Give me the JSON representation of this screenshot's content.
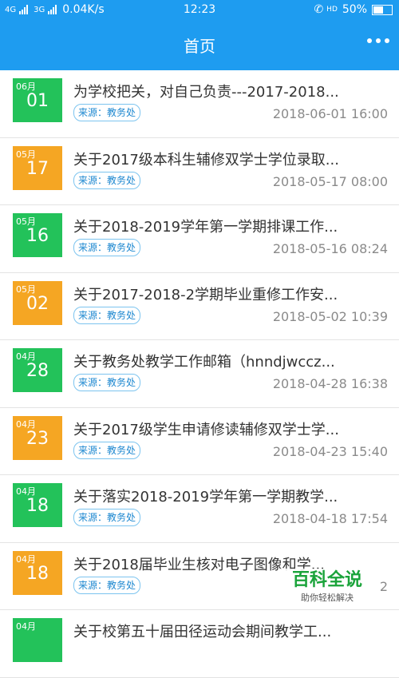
{
  "status": {
    "signal_left": "4G",
    "signal_right": "3G",
    "speed": "0.04K/s",
    "time": "12:23",
    "network": "HD",
    "battery": "50%"
  },
  "header": {
    "title": "首页"
  },
  "items": [
    {
      "month": "06月",
      "day": "01",
      "color": "#23c25a",
      "title": "为学校把关，对自己负责---2017-2018...",
      "source": "来源：教务处",
      "time": "2018-06-01 16:00"
    },
    {
      "month": "05月",
      "day": "17",
      "color": "#f5a623",
      "title": "关于2017级本科生辅修双学士学位录取...",
      "source": "来源：教务处",
      "time": "2018-05-17 08:00"
    },
    {
      "month": "05月",
      "day": "16",
      "color": "#23c25a",
      "title": "关于2018-2019学年第一学期排课工作...",
      "source": "来源：教务处",
      "time": "2018-05-16 08:24"
    },
    {
      "month": "05月",
      "day": "02",
      "color": "#f5a623",
      "title": "关于2017-2018-2学期毕业重修工作安...",
      "source": "来源：教务处",
      "time": "2018-05-02 10:39"
    },
    {
      "month": "04月",
      "day": "28",
      "color": "#23c25a",
      "title": "关于教务处教学工作邮箱（hnndjwccz...",
      "source": "来源：教务处",
      "time": "2018-04-28 16:38"
    },
    {
      "month": "04月",
      "day": "23",
      "color": "#f5a623",
      "title": "关于2017级学生申请修读辅修双学士学...",
      "source": "来源：教务处",
      "time": "2018-04-23 15:40"
    },
    {
      "month": "04月",
      "day": "18",
      "color": "#23c25a",
      "title": "关于落实2018-2019学年第一学期教学...",
      "source": "来源：教务处",
      "time": "2018-04-18 17:54"
    },
    {
      "month": "04月",
      "day": "18",
      "color": "#f5a623",
      "title": "关于2018届毕业生核对电子图像和学...",
      "source": "来源：教务处",
      "time": "2"
    },
    {
      "month": "04月",
      "day": "",
      "color": "#23c25a",
      "title": "关于校第五十届田径运动会期间教学工...",
      "source": "",
      "time": ""
    }
  ],
  "watermark": {
    "title": "百科全说",
    "subtitle": "助你轻松解决"
  }
}
